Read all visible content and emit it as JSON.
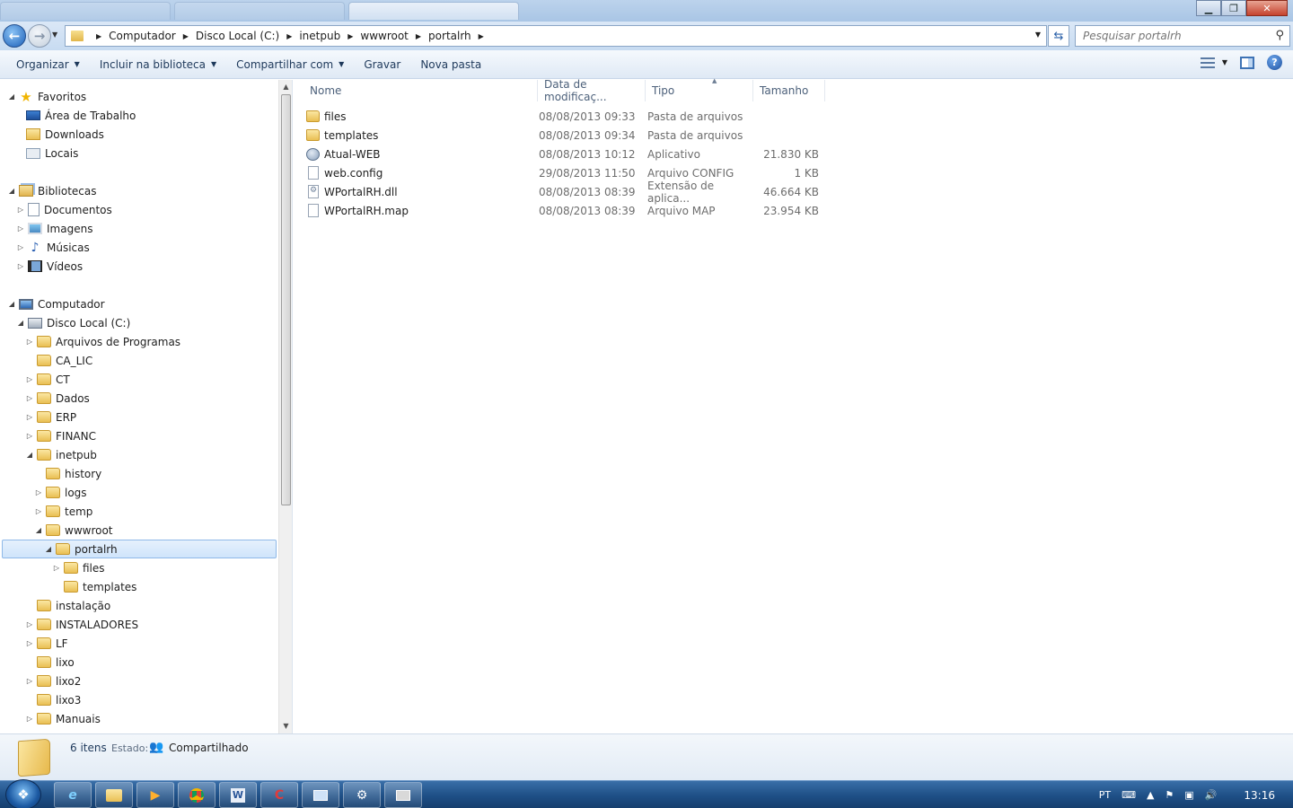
{
  "window": {
    "minimize": "▁",
    "maximize": "❐",
    "close": "✕"
  },
  "address": {
    "crumbs": [
      "Computador",
      "Disco Local (C:)",
      "inetpub",
      "wwwroot",
      "portalrh"
    ],
    "search_placeholder": "Pesquisar portalrh"
  },
  "toolbar": {
    "organize": "Organizar",
    "include_library": "Incluir na biblioteca",
    "share_with": "Compartilhar com",
    "burn": "Gravar",
    "new_folder": "Nova pasta",
    "help": "?"
  },
  "nav": {
    "favorites": "Favoritos",
    "desktop": "Área de Trabalho",
    "downloads": "Downloads",
    "places": "Locais",
    "libraries": "Bibliotecas",
    "documents": "Documentos",
    "images": "Imagens",
    "music": "Músicas",
    "videos": "Vídeos",
    "computer": "Computador",
    "local_disk": "Disco Local (C:)",
    "folders": [
      "Arquivos de Programas",
      "CA_LIC",
      "CT",
      "Dados",
      "ERP",
      "FINANC",
      "inetpub",
      "history",
      "logs",
      "temp",
      "wwwroot",
      "portalrh",
      "files",
      "templates",
      "instalação",
      "INSTALADORES",
      "LF",
      "lixo",
      "lixo2",
      "lixo3",
      "Manuais"
    ]
  },
  "columns": {
    "name": "Nome",
    "date": "Data de modificaç...",
    "type": "Tipo",
    "size": "Tamanho"
  },
  "files": [
    {
      "name": "files",
      "date": "08/08/2013 09:33",
      "type": "Pasta de arquivos",
      "size": "",
      "icon": "folder-icon"
    },
    {
      "name": "templates",
      "date": "08/08/2013 09:34",
      "type": "Pasta de arquivos",
      "size": "",
      "icon": "folder-icon"
    },
    {
      "name": "Atual-WEB",
      "date": "08/08/2013 10:12",
      "type": "Aplicativo",
      "size": "21.830 KB",
      "icon": "application-icon"
    },
    {
      "name": "web.config",
      "date": "29/08/2013 11:50",
      "type": "Arquivo CONFIG",
      "size": "1 KB",
      "icon": "file-icon"
    },
    {
      "name": "WPortalRH.dll",
      "date": "08/08/2013 08:39",
      "type": "Extensão de aplica...",
      "size": "46.664 KB",
      "icon": "dll-icon"
    },
    {
      "name": "WPortalRH.map",
      "date": "08/08/2013 08:39",
      "type": "Arquivo MAP",
      "size": "23.954 KB",
      "icon": "file-icon"
    }
  ],
  "details": {
    "count": "6 itens",
    "state_label": "Estado:",
    "state_value": "Compartilhado"
  },
  "taskbar": {
    "language": "PT",
    "clock": "13:16"
  }
}
